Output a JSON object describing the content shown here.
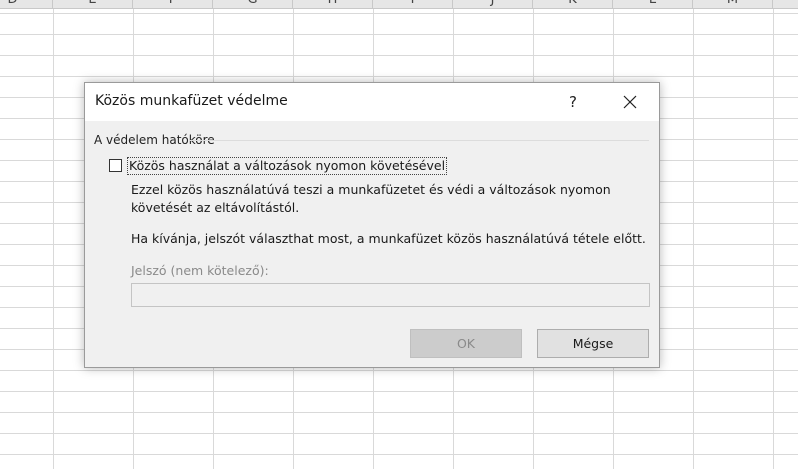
{
  "spreadsheet": {
    "columns": [
      "D",
      "E",
      "F",
      "G",
      "H",
      "I",
      "J",
      "K",
      "L",
      "M"
    ]
  },
  "dialog": {
    "title": "Közös munkafüzet védelme",
    "help": "?",
    "close_icon": "close-icon",
    "group_title": "A védelem hatóköre",
    "checkbox_label": "Közös használat a változások nyomon követésével",
    "checkbox_checked": false,
    "description": "Ezzel közös használatúvá teszi a munkafüzetet és védi a változások nyomon követését az eltávolítástól.",
    "info": "Ha kívánja, jelszót választhat most, a munkafüzet közös használatúvá tétele előtt.",
    "password_label": "Jelszó (nem kötelező):",
    "password_value": "",
    "ok_label": "OK",
    "cancel_label": "Mégse"
  }
}
